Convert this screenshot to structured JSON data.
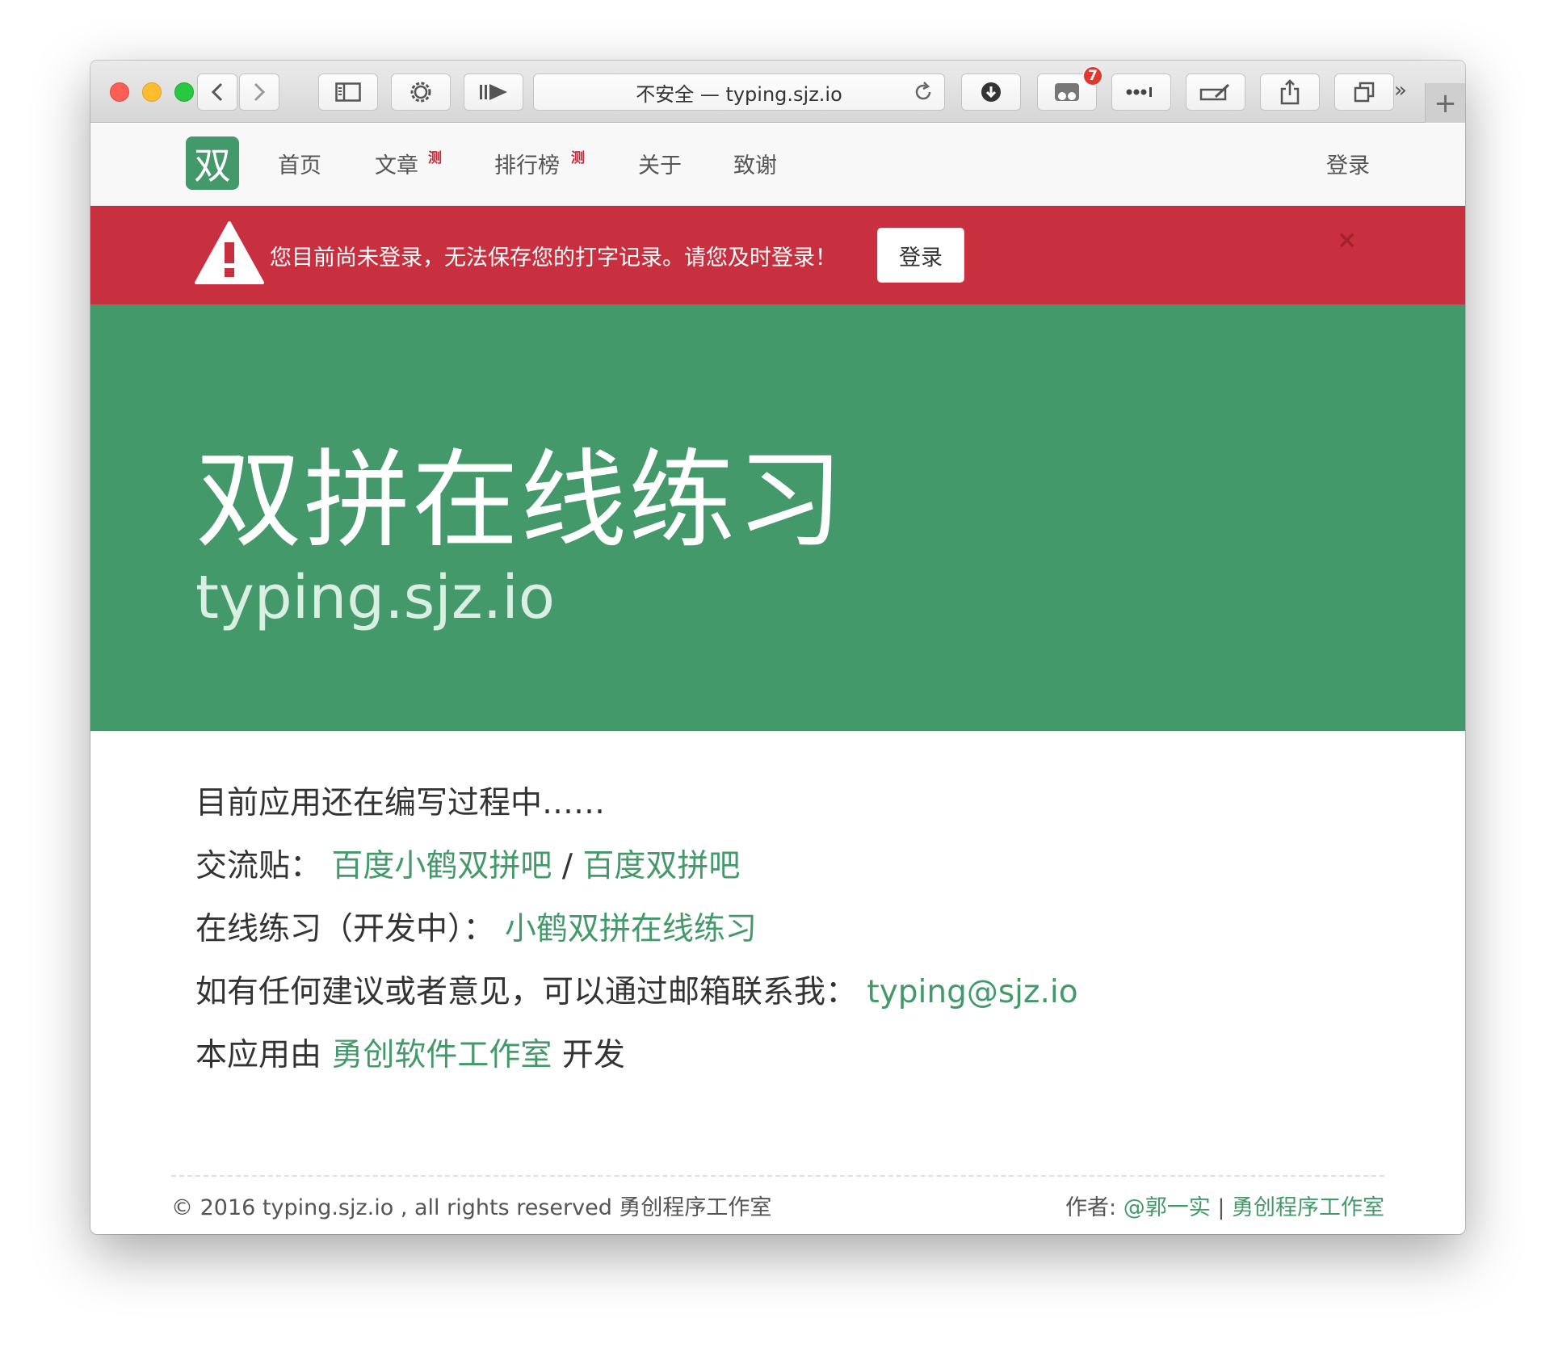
{
  "browser": {
    "url_text": "不安全 — typing.sjz.io",
    "badge_count": "7"
  },
  "nav": {
    "logo": "双",
    "items": [
      {
        "label": "首页"
      },
      {
        "label": "文章",
        "sup": "测"
      },
      {
        "label": "排行榜",
        "sup": "测"
      },
      {
        "label": "关于"
      },
      {
        "label": "致谢"
      }
    ],
    "login": "登录"
  },
  "alert": {
    "message": "您目前尚未登录，无法保存您的打字记录。请您及时登录！",
    "login_button": "登录",
    "close": "×"
  },
  "hero": {
    "title": "双拼在线练习",
    "subtitle": "typing.sjz.io"
  },
  "content": {
    "line1": "目前应用还在编写过程中……",
    "line2_label": "交流贴：",
    "line2_link1": "百度小鹤双拼吧",
    "line2_sep": " / ",
    "line2_link2": "百度双拼吧",
    "line3_label": "在线练习（开发中）：",
    "line3_link": "小鹤双拼在线练习",
    "line4_label": "如有任何建议或者意见，可以通过邮箱联系我：",
    "line4_link": "typing@sjz.io",
    "line5_pre": "本应用由",
    "line5_link": "勇创软件工作室",
    "line5_post": "开发"
  },
  "footer": {
    "copyright": "© 2016   typing.sjz.io , all rights reserved 勇创程序工作室",
    "author_label": "作者: ",
    "author_link": "@郭一实",
    "sep": " | ",
    "studio_link": "勇创程序工作室"
  },
  "colors": {
    "brand_green": "#44996a",
    "alert_red": "#c9303f"
  }
}
